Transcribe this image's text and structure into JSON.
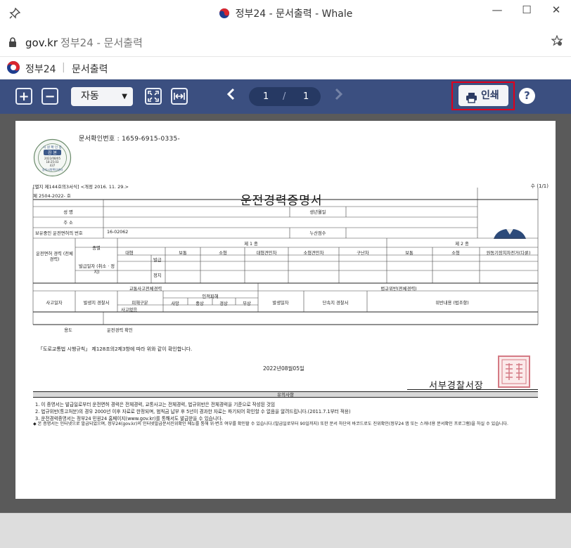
{
  "window": {
    "title": "정부24 - 문서출력 - Whale",
    "controls": [
      "—",
      "☐",
      "✕"
    ]
  },
  "address_bar": {
    "domain": "gov.kr",
    "page_title": "정부24 - 문서출력"
  },
  "site_header": {
    "brand": "정부24",
    "separator": "|",
    "page": "문서출력"
  },
  "toolbar": {
    "zoom_in": "+",
    "zoom_out": "−",
    "zoom_value": "자동",
    "page_current": "1",
    "page_separator": "/",
    "page_total": "1",
    "print_label": "인쇄",
    "help_label": "?",
    "accent": "#3b4f80",
    "highlight": "#e0001b"
  },
  "document": {
    "seal_text": [
      "시 원 확 인 용",
      "진 본",
      "2022/08/05",
      "18:25:03",
      "437",
      "경부시원확인센터"
    ],
    "confirm_number": "문서확인번호 : 1659-6915-0335-",
    "form_note": "[별지 제144호의3서식] <개정 2016. 11. 29.>",
    "page_count": "수 (1/1)",
    "doc_number": "제 2504-2022-        호",
    "title": "운전경력증명서",
    "labels": {
      "name": "성    명",
      "birth": "생년월일",
      "address": "주    소",
      "license_no": "보유중인 운전면허의 번호",
      "license_no_value": "16-02062",
      "cumulative": "누산점수",
      "class1": "제 1 종",
      "class2": "제 2 종",
      "license_type": "운전면허 경력 (전체경력)",
      "kind": "종별",
      "date": "발급일자 (취소 · 정지)",
      "issued": "발급",
      "suspended": "정지",
      "traffic": "교통사고전체경력",
      "violation": "법규위반(전체경력)",
      "accident_date": "사고일자",
      "police_station": "발생지 경찰서",
      "victim": "피해구분",
      "casualties": "인적피해",
      "death": "사망",
      "serious": "중상",
      "minor": "경상",
      "injury": "부상",
      "none": "사고없음",
      "violation_date": "발생일자",
      "enforcement": "단속지 경찰서",
      "violation_content": "위반내용 (법조항)",
      "purpose": "용도",
      "purpose_value": "운전경력 확인"
    },
    "class1_cols": [
      "대형",
      "보통",
      "소형",
      "대형견인차",
      "소형견인차",
      "구난차"
    ],
    "class2_cols": [
      "보통",
      "소형",
      "원동기장치자전거(다륜)"
    ],
    "legal_text": "「도로교통법 시행규칙」 제128조의2제3항에 따라 위와 같이 확인합니다.",
    "issue_date": "2022년08월05일",
    "issuer": "서부경찰서장",
    "notes_title": "유의사항",
    "notes": [
      "1. 이 증명서는 발급일로부터 운전면허 경력은 전체경력, 교통사고는 전체경력, 법규위반은 전체경력을 기준으로 작성된 것임",
      "2. 법규위반(통고처분)의 경우 2000년 이후 자료로 한정되며, 범칙금 납부 후 5년이 경과한 자료는 파기되어 확인할 수 없음을 알려드립니다.(2011.7.1부터 적용)",
      "3. 운전경력증명서는 정부24 민원24 홈페이지(www.gov.kr)를 통해서도 발급받을 수 있습니다.",
      "◆ 본 증명서는 인터넷으로 발급되었으며, 정부24(gov.kr)의 인터넷발급문서진위확인 메뉴를 통해 위·변조 여부를 확인할 수 있습니다.(발급일로부터 90일까지) 또한 문서 하단의 바코드로도 진위확인(정부24 앱 또는 스캐너용 문서확인 프로그램)을 하실 수 있습니다."
    ]
  }
}
